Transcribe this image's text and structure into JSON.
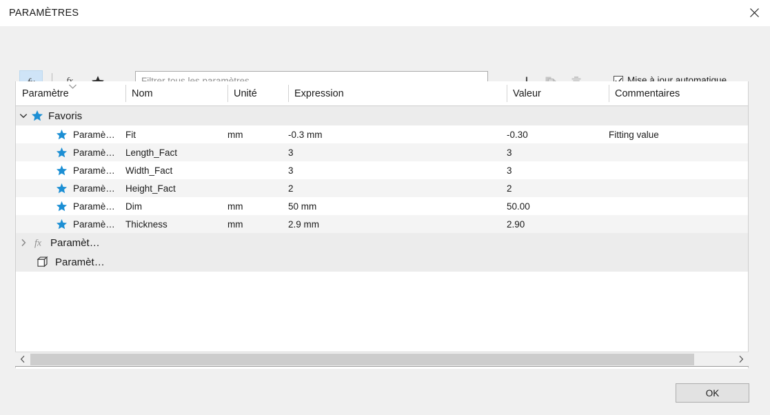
{
  "window": {
    "title": "PARAMÈTRES",
    "close_icon": "close-icon"
  },
  "toolbar": {
    "fx_button": {
      "icon": "fx-icon",
      "tooltip": "fx",
      "selected": true
    },
    "fx_user_button": {
      "icon": "fx-user-icon"
    },
    "favorite_button": {
      "icon": "star-icon"
    },
    "add_button": {
      "icon": "plus-icon"
    },
    "copy_button": {
      "icon": "copy-icon",
      "disabled": true
    },
    "delete_button": {
      "icon": "trash-icon",
      "disabled": true
    },
    "filter": {
      "placeholder": "Filtrer tous les paramètres",
      "value": ""
    },
    "auto_update": {
      "label": "Mise à jour automatique",
      "checked": true
    }
  },
  "table": {
    "columns": [
      {
        "label": "Paramètre"
      },
      {
        "label": "Nom"
      },
      {
        "label": "Unité"
      },
      {
        "label": "Expression"
      },
      {
        "label": "Valeur"
      },
      {
        "label": "Commentaires"
      }
    ],
    "groups": [
      {
        "name": "Favoris",
        "icon": "star-icon",
        "expanded": true,
        "rows": [
          {
            "parametre": "Paramè…",
            "nom": "Fit",
            "unite": "mm",
            "expression": "-0.3 mm",
            "valeur": "-0.30",
            "commentaires": "Fitting value"
          },
          {
            "parametre": "Paramè…",
            "nom": "Length_Fact",
            "unite": "",
            "expression": "3",
            "valeur": "3",
            "commentaires": ""
          },
          {
            "parametre": "Paramè…",
            "nom": "Width_Fact",
            "unite": "",
            "expression": "3",
            "valeur": "3",
            "commentaires": ""
          },
          {
            "parametre": "Paramè…",
            "nom": "Height_Fact",
            "unite": "",
            "expression": "2",
            "valeur": "2",
            "commentaires": ""
          },
          {
            "parametre": "Paramè…",
            "nom": "Dim",
            "unite": "mm",
            "expression": "50 mm",
            "valeur": "50.00",
            "commentaires": ""
          },
          {
            "parametre": "Paramè…",
            "nom": "Thickness",
            "unite": "mm",
            "expression": "2.9 mm",
            "valeur": "2.90",
            "commentaires": ""
          }
        ]
      },
      {
        "name": "Paramèt…",
        "icon": "fx-icon",
        "expanded": false,
        "rows": []
      },
      {
        "name": "Paramèt…",
        "icon": "cube-icon",
        "expanded": null,
        "rows": []
      }
    ]
  },
  "scrollbar": {
    "left_arrow": "chevron-left-icon",
    "right_arrow": "chevron-right-icon"
  },
  "footer": {
    "ok_label": "OK"
  },
  "colors": {
    "accent_star": "#1c8fd4",
    "fx_selected_bg": "#cfe4f7",
    "row_alt": "#f4f4f4",
    "group_row": "#ececec",
    "window_bg": "#f0f0f0"
  }
}
